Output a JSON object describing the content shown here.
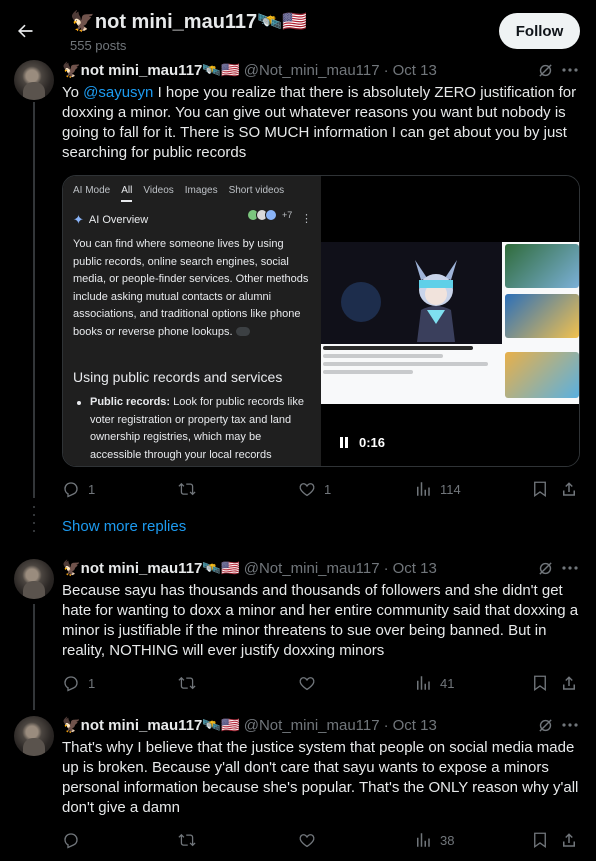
{
  "header": {
    "title": "🦅not mini_mau117🛰️🇺🇸",
    "posts": "555 posts",
    "follow_label": "Follow"
  },
  "tweets": [
    {
      "name": "🦅not mini_mau117🛰️🇺🇸",
      "handle": "@Not_mini_mau117",
      "date": "Oct 13",
      "text_pre": "Yo ",
      "mention": "@sayusyn",
      "text_post": " I hope you realize that there is absolutely ZERO justification for doxxing a minor. You can give out whatever reasons you want but nobody is going to fall for it. There is SO MUCH information I can get about you by just searching for public records",
      "replies": "1",
      "reposts": "",
      "likes": "1",
      "views": "114"
    },
    {
      "name": "🦅not mini_mau117🛰️🇺🇸",
      "handle": "@Not_mini_mau117",
      "date": "Oct 13",
      "text": "Because sayu has thousands and thousands of followers and she didn't get hate for wanting to doxx a minor and her entire community said that doxxing a minor is justifiable if the minor threatens to sue over being banned. But in reality, NOTHING will ever justify doxxing minors",
      "replies": "1",
      "reposts": "",
      "likes": "",
      "views": "41"
    },
    {
      "name": "🦅not mini_mau117🛰️🇺🇸",
      "handle": "@Not_mini_mau117",
      "date": "Oct 13",
      "text": "That's why I believe that the justice system that people on social media made up is broken. Because y'all don't care that sayu wants to expose a minors personal information because she's popular. That's the ONLY reason why y'all don't give a damn",
      "replies": "",
      "reposts": "",
      "likes": "",
      "views": "38"
    }
  ],
  "media": {
    "tabs": [
      "AI Mode",
      "All",
      "Videos",
      "Images",
      "Short videos"
    ],
    "active_tab": "All",
    "ai_overview_label": "AI Overview",
    "badge_count": "+7",
    "overview_text": "You can find where someone lives by using public records, online search engines, social media, or people-finder services. Other methods include asking mutual contacts or alumni associations, and traditional options like phone books or reverse phone lookups.",
    "subheading": "Using public records and services",
    "bullet_bold": "Public records:",
    "bullet_text": " Look for public records like voter registration or property tax and land ownership registries, which may be accessible through your local records",
    "video_time": "0:16"
  },
  "show_more_label": "Show more replies",
  "colors": {
    "accent": "#1d9bf0",
    "muted": "#71767b",
    "text": "#e7e9ea",
    "background": "#000000"
  }
}
